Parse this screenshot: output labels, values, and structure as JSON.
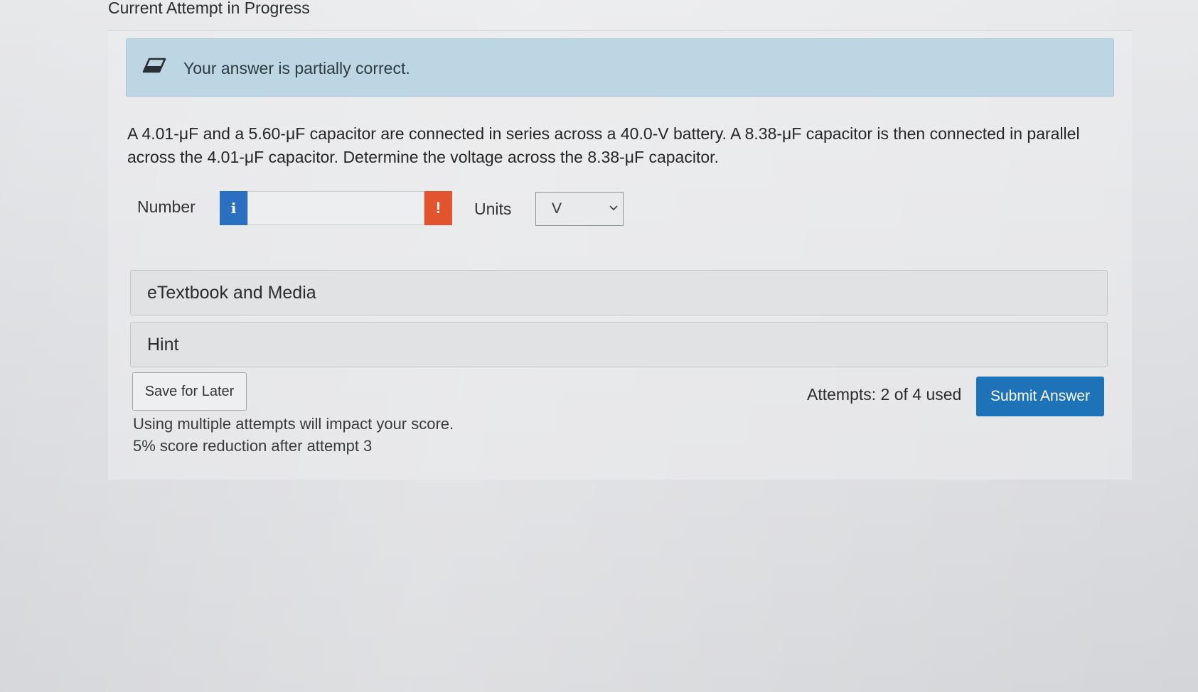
{
  "page": {
    "heading": "Current Attempt in Progress"
  },
  "feedback": {
    "icon": "eraser-icon",
    "message": "Your answer is partially correct."
  },
  "question": {
    "text_line1": "A 4.01-μF and a 5.60-μF capacitor are connected in series across a 40.0-V battery. A 8.38-μF capacitor is then connected in parallel",
    "text_line2": "across the 4.01-μF capacitor. Determine the voltage across the 8.38-μF capacitor."
  },
  "answer": {
    "number_label": "Number",
    "info_icon_glyph": "i",
    "number_value": "",
    "warning_icon_glyph": "!",
    "units_label": "Units",
    "units_selected": "V"
  },
  "sections": {
    "etextbook_label": "eTextbook and Media",
    "hint_label": "Hint"
  },
  "actions": {
    "save_label": "Save for Later",
    "attempts_text": "Attempts: 2 of 4 used",
    "submit_label": "Submit Answer"
  },
  "notes": {
    "line1": "Using multiple attempts will impact your score.",
    "line2": "5% score reduction after attempt 3"
  },
  "colors": {
    "feedback_bg": "#bcd6e3",
    "info_blue": "#2a6fc0",
    "warning_orange": "#e2542e",
    "submit_blue": "#1d72b8"
  }
}
